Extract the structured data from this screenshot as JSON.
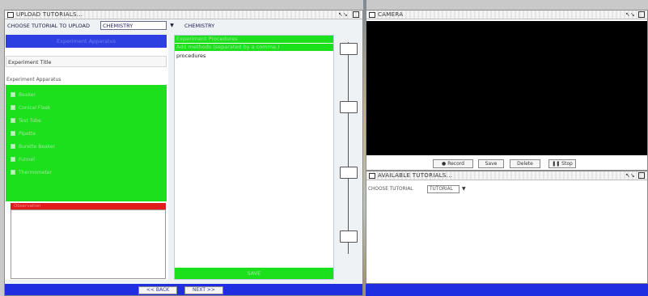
{
  "upload_window": {
    "title": "UPLOAD TUTORIALS...",
    "controls": {
      "minimize": "↖↘",
      "close": ""
    },
    "chooser_label": "CHOOSE TUTORIAL TO UPLOAD",
    "chooser_value": "CHEMISTRY",
    "chooser_arrow": "▼",
    "current_subject": "CHEMISTRY",
    "left": {
      "header": "Experiment Apparatus",
      "title_field": "Experiment Title",
      "apparatus_label": "Experiment Apparatus",
      "apparatus_items": [
        "Beaker",
        "Conical Flask",
        "Test Tube",
        "Pipette",
        "Burette Beaker",
        "Funnel",
        "Thermometer"
      ],
      "notes_header": "Observation"
    },
    "middle": {
      "header": "Experiment Procedures",
      "subheader": "Add methods (separated by a comma.)",
      "text": "procedures",
      "save_label": "SAVE"
    },
    "nav": {
      "back_label": "<< BACK",
      "next_label": "NEXT >>"
    }
  },
  "camera_window": {
    "title": "CAMERA",
    "controls": {
      "minimize": "↖↘"
    },
    "buttons": {
      "record": "Record",
      "save": "Save",
      "delete": "Delete",
      "stop": "Stop"
    }
  },
  "tutorials_window": {
    "title": "AVAILABLE TUTORIALS...",
    "controls": {
      "minimize": "↖↘"
    },
    "choose_label": "CHOOSE TUTORIAL",
    "choose_value": "TUTORIAL",
    "choose_arrow": "▼"
  },
  "colors": {
    "accent_blue": "#1f2ee0",
    "panel_green": "#1be01b",
    "alert_red": "#e01c1c",
    "camera_black": "#000000"
  },
  "slider": {
    "knob_positions": [
      0.02,
      0.3,
      0.62,
      0.93
    ]
  }
}
